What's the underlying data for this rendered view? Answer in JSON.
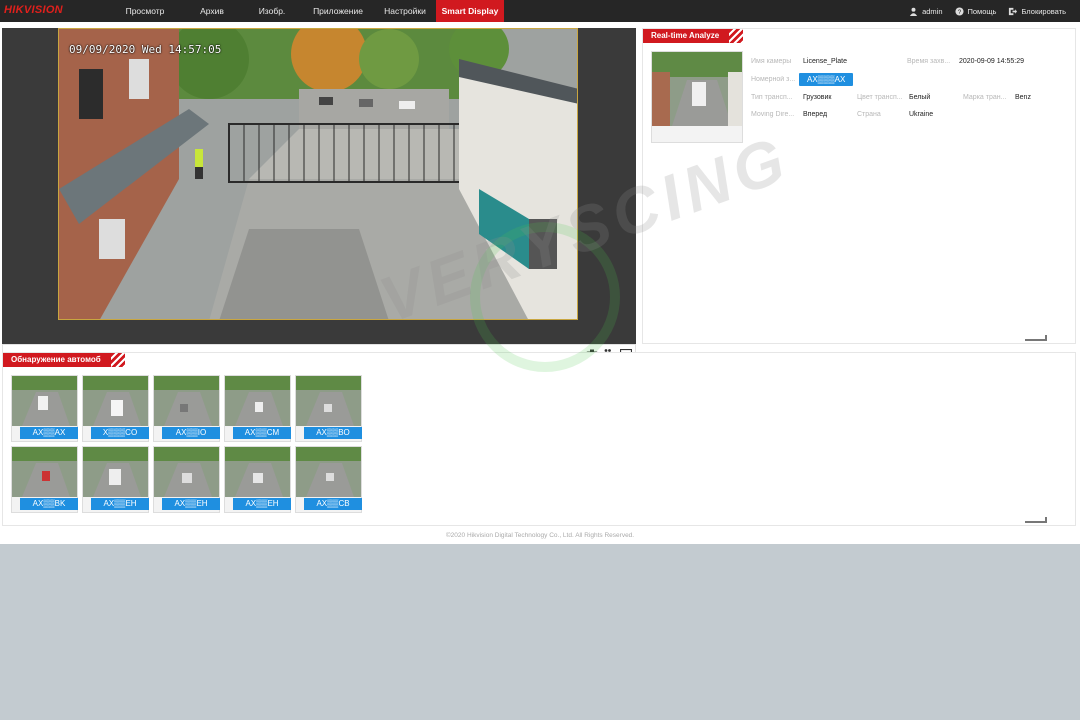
{
  "brand": {
    "logo": "HIKVISION",
    "accent": "#d1191f",
    "plate_color": "#1f8fe0"
  },
  "nav": {
    "items": [
      {
        "label": "Просмотр"
      },
      {
        "label": "Архив"
      },
      {
        "label": "Изобр."
      },
      {
        "label": "Приложение"
      },
      {
        "label": "Настройки"
      },
      {
        "label": "Smart Display",
        "active": true
      }
    ]
  },
  "topright": {
    "user": "admin",
    "help": "Помощь",
    "lock": "Блокировать"
  },
  "video": {
    "timestamp": "09/09/2020 Wed 14:57:05",
    "tools": [
      "camera-icon",
      "record-icon",
      "fullscreen-icon"
    ]
  },
  "analyze": {
    "title": "Real-time Analyze",
    "rows": [
      [
        {
          "label": "Имя камеры",
          "value": "License_Plate"
        },
        {
          "label": "Время захв...",
          "value": "2020-09-09 14:55:29"
        }
      ],
      [
        {
          "label": "Номерной з...",
          "value": "AX▒▒▒AX",
          "plate": true
        }
      ],
      [
        {
          "label": "Тип трансп...",
          "value": "Грузовик"
        },
        {
          "label": "Цвет трансп...",
          "value": "Белый"
        },
        {
          "label": "Марка тран...",
          "value": "Benz"
        }
      ],
      [
        {
          "label": "Moving Dire...",
          "value": "Вперед"
        },
        {
          "label": "Страна",
          "value": "Ukraine"
        }
      ]
    ]
  },
  "detection": {
    "title": "Обнаружение автомоб",
    "plates": [
      "AX▒▒AX",
      "X▒▒▒CO",
      "AX▒▒IO",
      "AX▒▒CM",
      "AX▒▒BO",
      "AX▒▒BK",
      "AX▒▒EH",
      "AX▒▒EH",
      "AX▒▒EH",
      "AX▒▒CB"
    ]
  },
  "footer": "©2020 Hikvision Digital Technology Co., Ltd. All Rights Reserved.",
  "watermark": "VERYSCING"
}
